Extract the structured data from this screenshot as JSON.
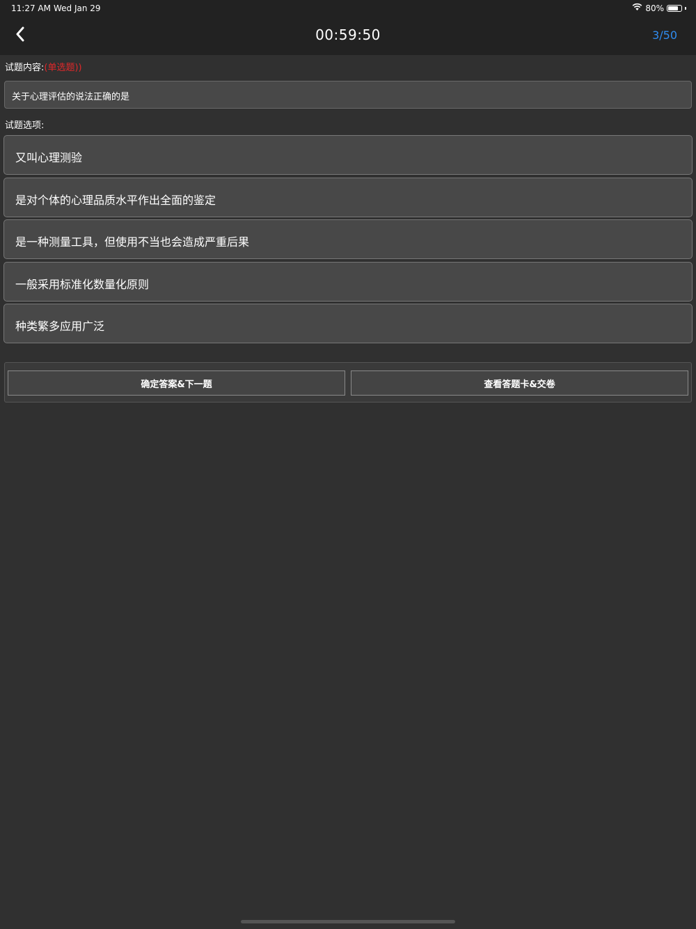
{
  "status_bar": {
    "time": "11:27 AM",
    "date": "Wed Jan 29",
    "battery_text": "80%",
    "battery_level": 0.8,
    "wifi_icon": "wifi-icon"
  },
  "nav": {
    "back_icon": "chevron-left-icon",
    "timer": "00:59:50",
    "progress": "3/50",
    "progress_color": "#2f8cf0"
  },
  "question": {
    "content_label": "试题内容:",
    "type_tag": "(单选题))",
    "type_color": "#e0282a",
    "text": "关于心理评估的说法正确的是",
    "options_label": "试题选项:",
    "options": [
      "又叫心理测验",
      "是对个体的心理品质水平作出全面的鉴定",
      "是一种测量工具，但使用不当也会造成严重后果",
      "一般采用标准化数量化原则",
      "种类繁多应用广泛"
    ]
  },
  "actions": {
    "confirm_label": "确定答案&下一题",
    "answer_card_label": "查看答题卡&交卷"
  }
}
